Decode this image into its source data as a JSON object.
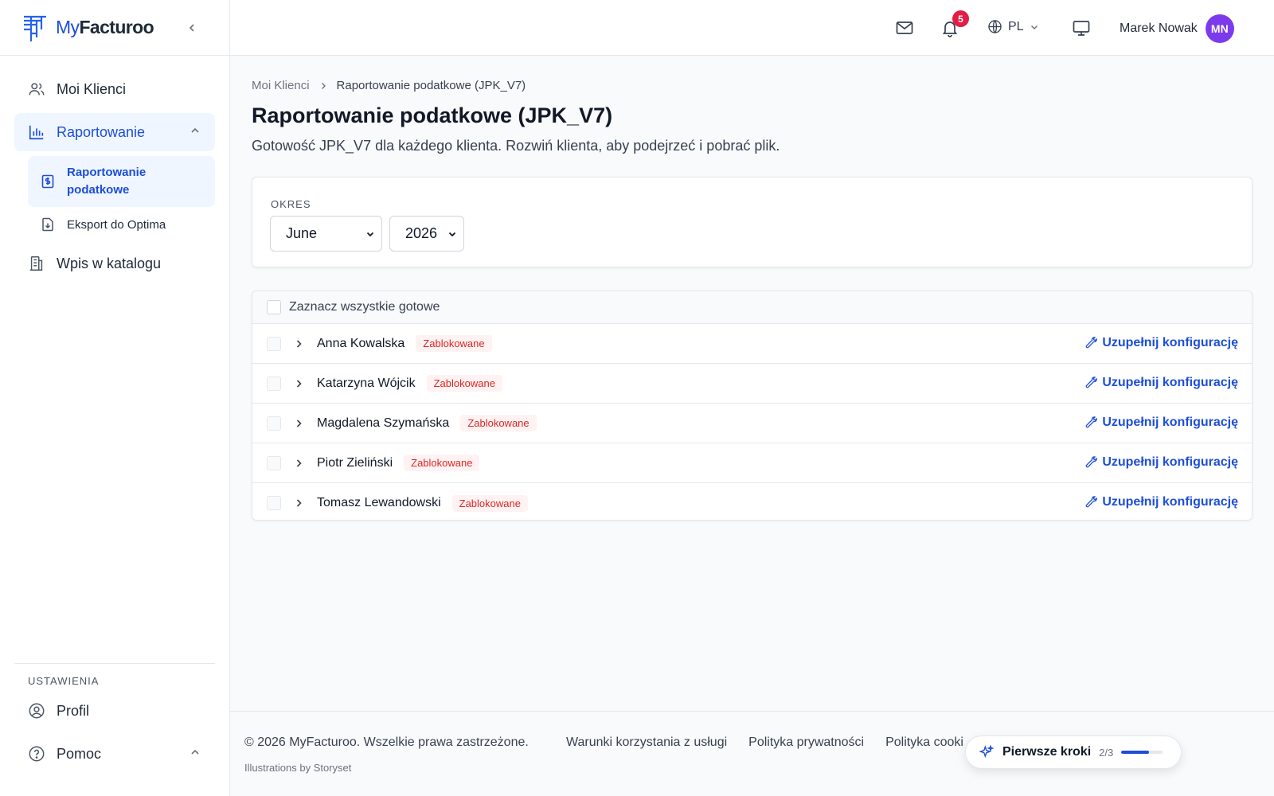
{
  "app": {
    "logo_part1": "My",
    "logo_part2": "Facturoo"
  },
  "sidebar": {
    "items": [
      {
        "label": "Moi Klienci",
        "icon": "users-icon"
      },
      {
        "label": "Raportowanie",
        "icon": "bar-chart-icon",
        "active": true
      },
      {
        "label": "Wpis w katalogu",
        "icon": "building-icon"
      }
    ],
    "sub_items": [
      {
        "label": "Raportowanie podatkowe",
        "icon": "tax-document-icon",
        "active": true
      },
      {
        "label": "Eksport do Optima",
        "icon": "file-download-icon"
      }
    ],
    "settings_title": "USTAWIENIA",
    "bottom_items": [
      {
        "label": "Profil",
        "icon": "user-circle-icon"
      },
      {
        "label": "Pomoc",
        "icon": "help-circle-icon"
      }
    ]
  },
  "topbar": {
    "notification_count": "5",
    "language": "PL",
    "user_name": "Marek Nowak",
    "user_initials": "MN",
    "avatar_color": "#7c3aed"
  },
  "breadcrumb": {
    "parent": "Moi Klienci",
    "current": "Raportowanie podatkowe (JPK_V7)"
  },
  "page": {
    "title": "Raportowanie podatkowe (JPK_V7)",
    "subtitle": "Gotowość JPK_V7 dla każdego klienta. Rozwiń klienta, aby podejrzeć i pobrać plik."
  },
  "period": {
    "label": "OKRES",
    "month": "June",
    "year": "2026"
  },
  "clients": {
    "select_all_label": "Zaznacz wszystkie gotowe",
    "config_action": "Uzupełnij konfigurację",
    "rows": [
      {
        "name": "Anna Kowalska",
        "status": "Zablokowane"
      },
      {
        "name": "Katarzyna Wójcik",
        "status": "Zablokowane"
      },
      {
        "name": "Magdalena Szymańska",
        "status": "Zablokowane"
      },
      {
        "name": "Piotr Zieliński",
        "status": "Zablokowane"
      },
      {
        "name": "Tomasz Lewandowski",
        "status": "Zablokowane"
      }
    ]
  },
  "footer": {
    "copyright": "© 2026 MyFacturoo. Wszelkie prawa zastrzeżone.",
    "links": [
      "Warunki korzystania z usługi",
      "Polityka prywatności",
      "Polityka cooki"
    ],
    "credits": "Illustrations by Storyset"
  },
  "onboarding": {
    "title": "Pierwsze kroki",
    "progress_text": "2/3",
    "progress_fraction": 0.67
  },
  "colors": {
    "accent": "#1d4ed8",
    "blocked": "#dc2626",
    "blocked_bg": "#fef2f2",
    "badge": "#e11d48"
  }
}
